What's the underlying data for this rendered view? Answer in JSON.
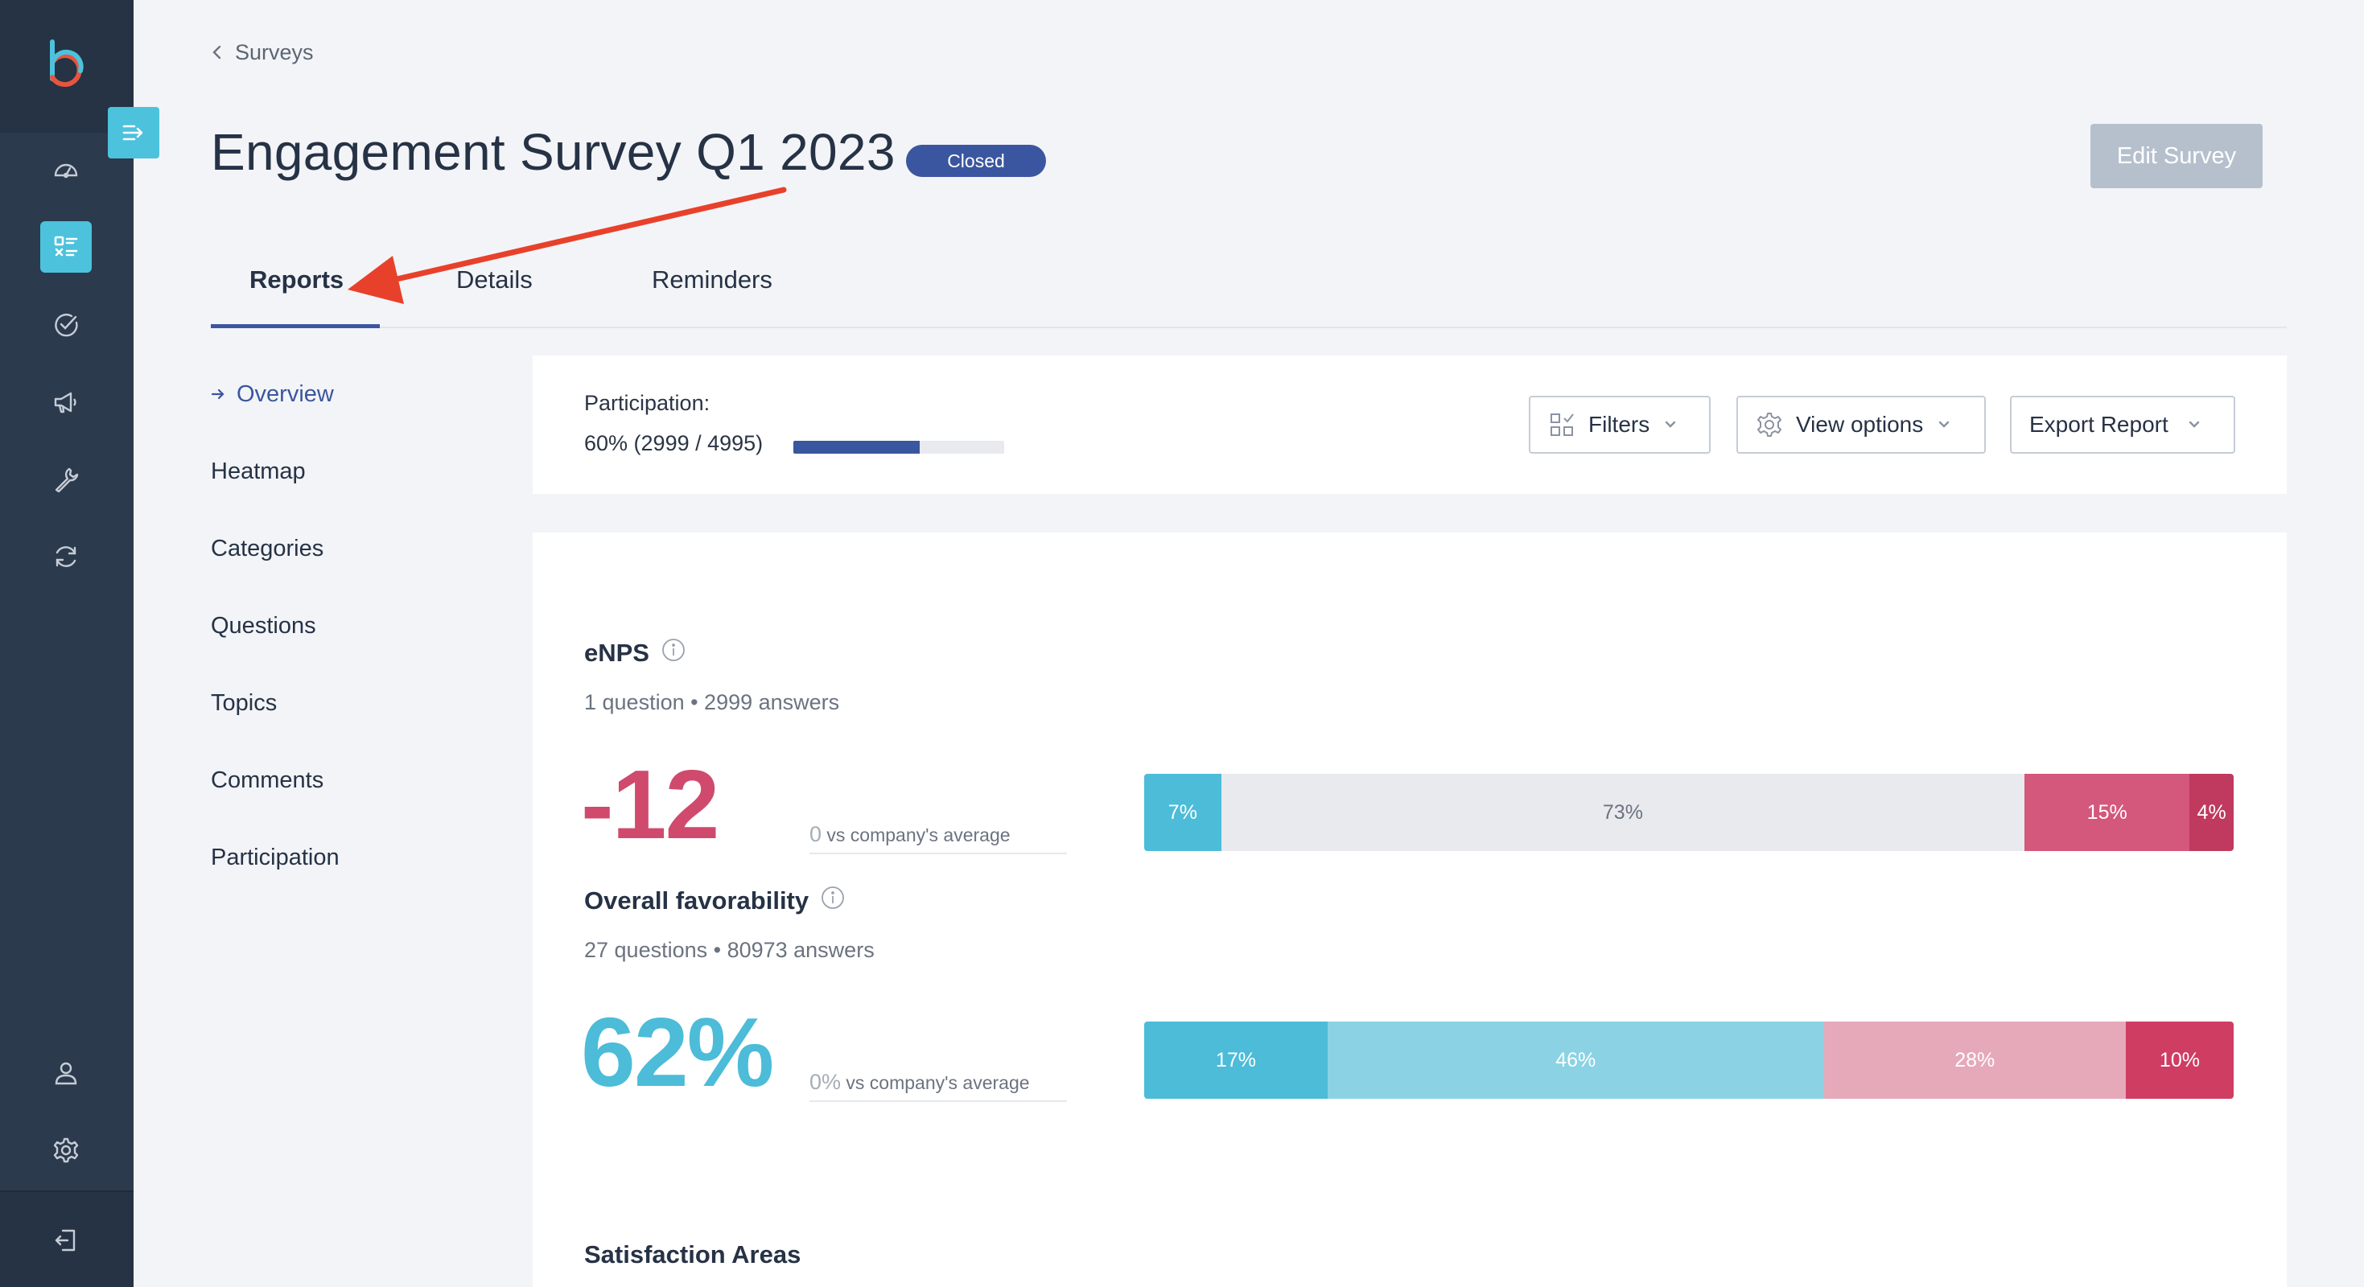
{
  "sidebar": {
    "icons": [
      "logo-b-icon",
      "dashboard-icon",
      "surveys-icon",
      "check-circle-icon",
      "megaphone-icon",
      "wrench-icon",
      "sync-icon",
      "user-icon",
      "settings-icon",
      "logout-icon"
    ]
  },
  "breadcrumb": {
    "label": "Surveys"
  },
  "header": {
    "title": "Engagement Survey Q1 2023",
    "status": "Closed",
    "edit_button": "Edit Survey"
  },
  "tabs": [
    {
      "label": "Reports",
      "active": true
    },
    {
      "label": "Details",
      "active": false
    },
    {
      "label": "Reminders",
      "active": false
    }
  ],
  "subnav": [
    {
      "label": "Overview",
      "active": true
    },
    {
      "label": "Heatmap",
      "active": false
    },
    {
      "label": "Categories",
      "active": false
    },
    {
      "label": "Questions",
      "active": false
    },
    {
      "label": "Topics",
      "active": false
    },
    {
      "label": "Comments",
      "active": false
    },
    {
      "label": "Participation",
      "active": false
    }
  ],
  "participation": {
    "label": "Participation:",
    "value_text": "60% (2999 / 4995)",
    "fraction": 0.6
  },
  "toolbar": {
    "filters": "Filters",
    "view_options": "View options",
    "export": "Export Report"
  },
  "enps": {
    "title": "eNPS",
    "subtitle": "1 question • 2999 answers",
    "value": "-12",
    "vs_num": "0",
    "vs_label": " vs company's average",
    "segments": [
      {
        "label": "7%",
        "value": 7,
        "color": "#4cbcd8",
        "text_color": "#ffffff"
      },
      {
        "label": "73%",
        "value": 73,
        "color": "#e9eaee",
        "text_color": "#6b7380"
      },
      {
        "label": "15%",
        "value": 15,
        "color": "#d4577c",
        "text_color": "#ffffff"
      },
      {
        "label": "4%",
        "value": 4,
        "color": "#bf3a5e",
        "text_color": "#ffffff"
      }
    ]
  },
  "favorability": {
    "title": "Overall favorability",
    "subtitle": "27 questions • 80973 answers",
    "value": "62%",
    "vs_num": "0%",
    "vs_label": " vs company's average",
    "segments": [
      {
        "label": "17%",
        "value": 17,
        "color": "#4cbcd8",
        "text_color": "#ffffff"
      },
      {
        "label": "46%",
        "value": 46,
        "color": "#8bd3e4",
        "text_color": "#ffffff"
      },
      {
        "label": "28%",
        "value": 28,
        "color": "#e6a9ba",
        "text_color": "#ffffff"
      },
      {
        "label": "10%",
        "value": 10,
        "color": "#cf3d62",
        "text_color": "#ffffff"
      }
    ]
  },
  "satisfaction": {
    "title": "Satisfaction Areas"
  },
  "colors": {
    "accent": "#4cc2dc",
    "brand_blue": "#3b56a0",
    "negative": "#d04a6e",
    "positive": "#4cbcd8",
    "annotation_arrow": "#e8412b"
  }
}
